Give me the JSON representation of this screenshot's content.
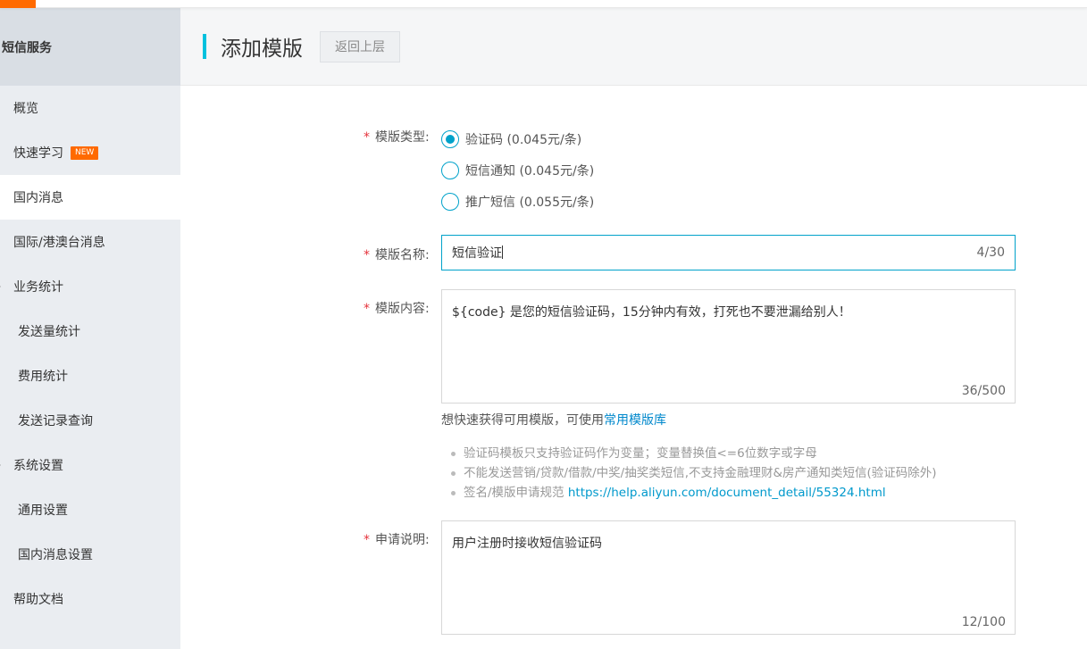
{
  "sidebar": {
    "header": "短信服务",
    "items": [
      {
        "label": "概览"
      },
      {
        "label": "快速学习",
        "badge": "NEW"
      },
      {
        "label": "国内消息"
      },
      {
        "label": "国际/港澳台消息"
      },
      {
        "label": "业务统计"
      },
      {
        "label": "发送量统计"
      },
      {
        "label": "费用统计"
      },
      {
        "label": "发送记录查询"
      },
      {
        "label": "系统设置"
      },
      {
        "label": "通用设置"
      },
      {
        "label": "国内消息设置"
      },
      {
        "label": "帮助文档"
      }
    ]
  },
  "page": {
    "title": "添加模版",
    "back_label": "返回上层"
  },
  "form": {
    "type_label": "模版类型:",
    "type_options": [
      {
        "label": "验证码 (0.045元/条)",
        "selected": true
      },
      {
        "label": "短信通知 (0.045元/条)",
        "selected": false
      },
      {
        "label": "推广短信 (0.055元/条)",
        "selected": false
      }
    ],
    "name_label": "模版名称:",
    "name_value": "短信验证",
    "name_counter": "4/30",
    "content_label": "模版内容:",
    "content_value": "${code} 是您的短信验证码，15分钟内有效，打死也不要泄漏给别人！",
    "content_counter": "36/500",
    "hint_text": "想快速获得可用模版，可使用",
    "hint_link": "常用模版库",
    "tips": [
      {
        "text": "验证码模板只支持验证码作为变量；变量替换值<=6位数字或字母",
        "link": ""
      },
      {
        "text": "不能发送营销/贷款/借款/中奖/抽奖类短信,不支持金融理财&房产通知类短信(验证码除外)",
        "link": ""
      },
      {
        "text": "签名/模版申请规范 ",
        "link": "https://help.aliyun.com/document_detail/55324.html"
      }
    ],
    "remark_label": "申请说明:",
    "remark_value": "用户注册时接收短信验证码",
    "remark_counter": "12/100",
    "required_mark": "*"
  },
  "colors": {
    "accent": "#00c1de",
    "brand": "#ff6a00",
    "primary": "#00a2ca",
    "required": "#e5323b",
    "link": "#0088cc"
  }
}
